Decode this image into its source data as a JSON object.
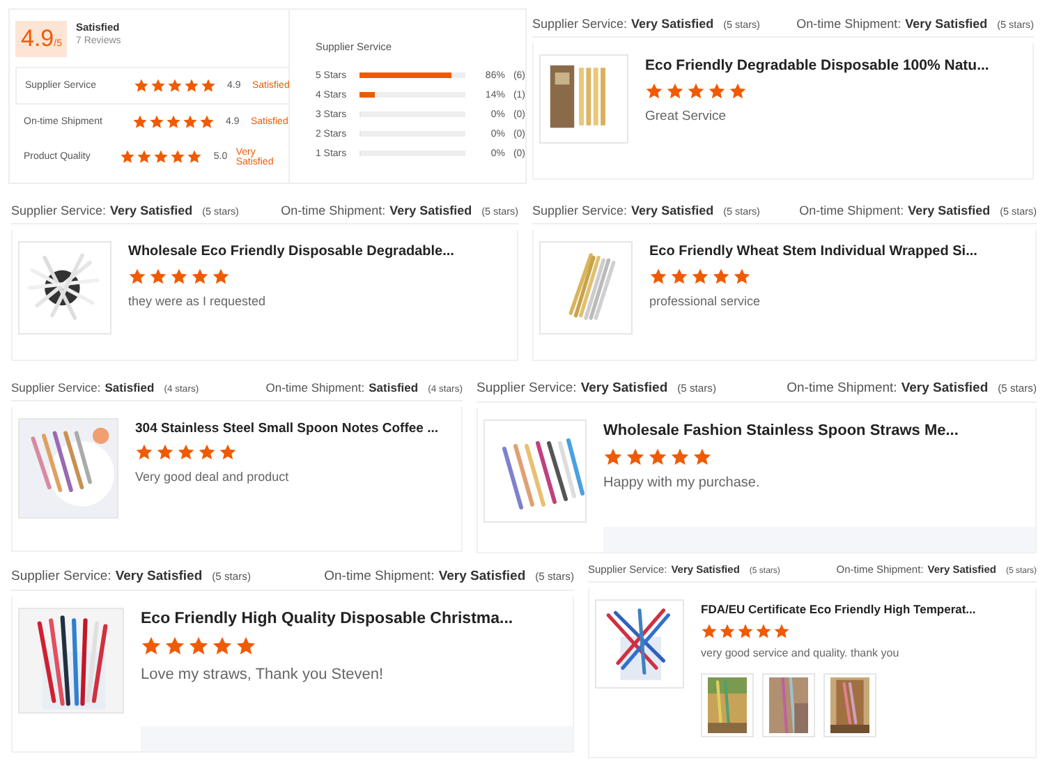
{
  "summary": {
    "score": "4.9",
    "out_of": "/5",
    "verdict": "Satisfied",
    "reviews": "7 Reviews",
    "criteria": [
      {
        "name": "Supplier Service",
        "stars": 5,
        "score": "4.9",
        "verdict": "Satisfied"
      },
      {
        "name": "On-time Shipment",
        "stars": 5,
        "score": "4.9",
        "verdict": "Satisfied"
      },
      {
        "name": "Product Quality",
        "stars": 5,
        "score": "5.0",
        "verdict": "Very Satisfied"
      }
    ],
    "breakdown": {
      "title": "Supplier Service",
      "rows": [
        {
          "label": "5 Stars",
          "level": 0.86,
          "percent": "86%",
          "count": "(6)"
        },
        {
          "label": "4 Stars",
          "level": 0.14,
          "percent": "14%",
          "count": "(1)"
        },
        {
          "label": "3 Stars",
          "level": 0,
          "percent": "0%",
          "count": "(0)"
        },
        {
          "label": "2 Stars",
          "level": 0,
          "percent": "0%",
          "count": "(0)"
        },
        {
          "label": "1 Stars",
          "level": 0,
          "percent": "0%",
          "count": "(0)"
        }
      ]
    }
  },
  "reviews": [
    {
      "supplier_label": "Supplier Service:",
      "supplier_value": "Very Satisfied",
      "supplier_stars": "(5 stars)",
      "shipment_label": "On-time Shipment:",
      "shipment_value": "Very Satisfied",
      "shipment_stars": "(5 stars)",
      "product": "Eco Friendly Degradable Disposable 100% Natu...",
      "stars": 5,
      "comment": "Great Service"
    },
    {
      "supplier_label": "Supplier Service:",
      "supplier_value": "Very Satisfied",
      "supplier_stars": "(5 stars)",
      "shipment_label": "On-time Shipment:",
      "shipment_value": "Very Satisfied",
      "shipment_stars": "(5 stars)",
      "product": "Wholesale Eco Friendly Disposable Degradable...",
      "stars": 5,
      "comment": "they were as I requested"
    },
    {
      "supplier_label": "Supplier Service:",
      "supplier_value": "Very Satisfied",
      "supplier_stars": "(5 stars)",
      "shipment_label": "On-time Shipment:",
      "shipment_value": "Very Satisfied",
      "shipment_stars": "(5 stars)",
      "product": "Eco Friendly Wheat Stem Individual Wrapped Si...",
      "stars": 5,
      "comment": "professional service"
    },
    {
      "supplier_label": "Supplier Service:",
      "supplier_value": "Satisfied",
      "supplier_stars": "(4 stars)",
      "shipment_label": "On-time Shipment:",
      "shipment_value": "Satisfied",
      "shipment_stars": "(4 stars)",
      "product": "304 Stainless Steel Small Spoon Notes Coffee ...",
      "stars": 5,
      "comment": "Very good deal and product"
    },
    {
      "supplier_label": "Supplier Service:",
      "supplier_value": "Very Satisfied",
      "supplier_stars": "(5 stars)",
      "shipment_label": "On-time Shipment:",
      "shipment_value": "Very Satisfied",
      "shipment_stars": "(5 stars)",
      "product": "Wholesale Fashion Stainless Spoon Straws Me...",
      "stars": 5,
      "comment": "Happy with my purchase.",
      "reply_box": true
    },
    {
      "supplier_label": "Supplier Service:",
      "supplier_value": "Very Satisfied",
      "supplier_stars": "(5 stars)",
      "shipment_label": "On-time Shipment:",
      "shipment_value": "Very Satisfied",
      "shipment_stars": "(5 stars)",
      "product": "Eco Friendly High Quality Disposable Christma...",
      "stars": 5,
      "comment": "Love my straws, Thank you Steven!",
      "reply_box": true
    },
    {
      "supplier_label": "Supplier Service:",
      "supplier_value": "Very Satisfied",
      "supplier_stars": "(5 stars)",
      "shipment_label": "On-time Shipment:",
      "shipment_value": "Very Satisfied",
      "shipment_stars": "(5 stars)",
      "product": "FDA/EU Certificate Eco Friendly High Temperat...",
      "stars": 5,
      "comment": "very good service and quality. thank you",
      "photos": [
        {
          "kind": "picture"
        },
        {
          "kind": "picture"
        },
        {
          "kind": "picture"
        }
      ]
    }
  ]
}
